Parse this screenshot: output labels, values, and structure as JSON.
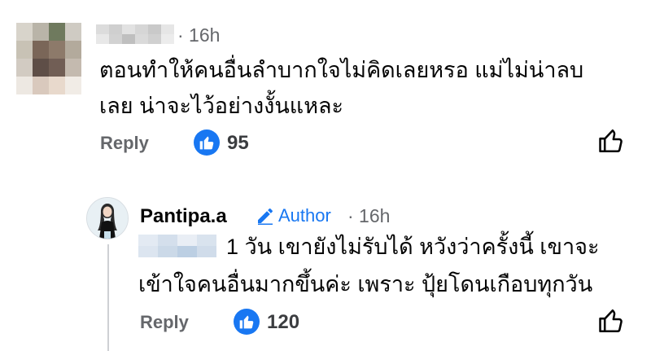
{
  "comments": [
    {
      "author_name_visible": "",
      "time": "· 16h",
      "text_line1": "ตอนทำให้คนอื่นลำบากใจไม่คิดเลยหรอ แม่ไม่น่าลบ",
      "text_line2": "เลย น่าจะไว้อย่างงั้นแหละ",
      "reply_label": "Reply",
      "like_count": "95",
      "avatar": "pixelated-avatar",
      "name": "pixelated-name"
    }
  ],
  "reply": {
    "author": "Pantipa.a",
    "badge_label": "Author",
    "badge_icon": "pencil-icon",
    "time": "· 16h",
    "text_line1": "1 วัน เขายังไม่รับได้ หวังว่าครั้งนี้ เขาจะ",
    "text_line2": "เข้าใจคนอื่นมากขึ้นค่ะ เพราะ ปุ้ยโดนเกือบทุกวัน",
    "mention": "pixelated-mention",
    "reply_label": "Reply",
    "like_count": "120"
  },
  "colors": {
    "accent": "#1877f2",
    "secondary_text": "#65676b",
    "primary_text": "#050505",
    "thread_line": "#ced0d4"
  }
}
